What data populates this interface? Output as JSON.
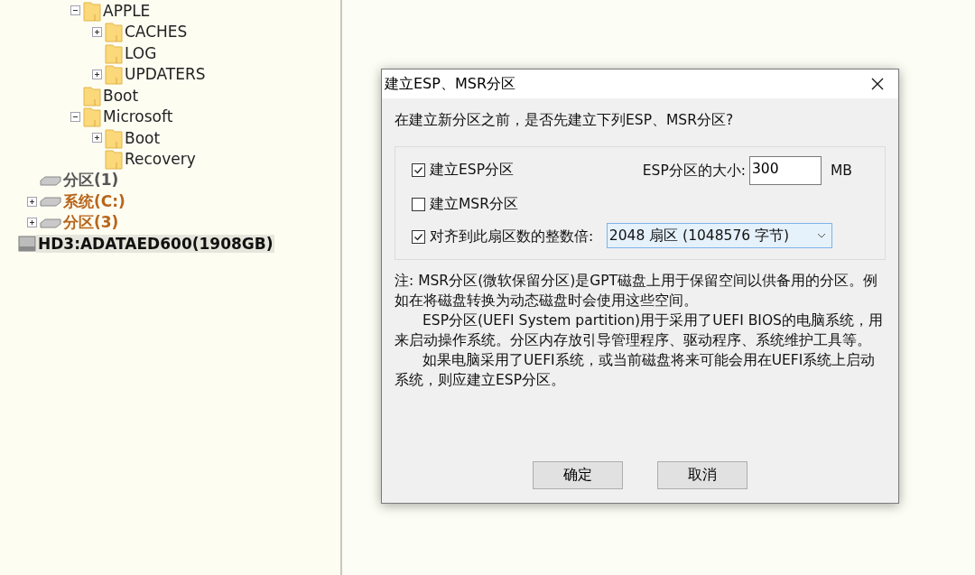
{
  "tree": [
    {
      "children": [
        {
          "children": [
            {
              "children": [
                {
                  "kind": "folder",
                  "label": "APPLE",
                  "expanded": true,
                  "selected": false,
                  "children": [
                    {
                      "kind": "folder",
                      "label": "CACHES",
                      "expanded": false,
                      "selected": false
                    },
                    {
                      "kind": "folder",
                      "label": "LOG",
                      "selected": false
                    },
                    {
                      "kind": "folder",
                      "label": "UPDATERS",
                      "expanded": false,
                      "selected": false
                    }
                  ]
                },
                {
                  "kind": "folder",
                  "label": "Boot",
                  "selected": false
                },
                {
                  "kind": "folder",
                  "label": "Microsoft",
                  "expanded": true,
                  "selected": false,
                  "children": [
                    {
                      "kind": "folder",
                      "label": "Boot",
                      "expanded": false,
                      "selected": false
                    },
                    {
                      "kind": "folder",
                      "label": "Recovery",
                      "selected": false
                    }
                  ]
                }
              ]
            }
          ]
        },
        {
          "kind": "partition",
          "label": "分区(1)",
          "color": "#555555",
          "selected": false
        },
        {
          "kind": "partition",
          "label": "系统(C:)",
          "color": "#b8651b",
          "expanded": false,
          "selected": false
        },
        {
          "kind": "partition",
          "label": "分区(3)",
          "color": "#b8651b",
          "expanded": false,
          "selected": false
        }
      ]
    },
    {
      "kind": "disk",
      "label": "HD3:ADATAED600(1908GB)",
      "selected": true
    }
  ],
  "dialog": {
    "title": "建立ESP、MSR分区",
    "question": "在建立新分区之前，是否先建立下列ESP、MSR分区?",
    "esp": {
      "label": "建立ESP分区",
      "checked": true
    },
    "size_label": "ESP分区的大小:",
    "size_value": "300",
    "size_unit": "MB",
    "msr": {
      "label": "建立MSR分区",
      "checked": false
    },
    "align": {
      "label": "对齐到此扇区数的整数倍:",
      "checked": true
    },
    "align_value": "2048 扇区 (1048576 字节)",
    "notes": [
      "注: MSR分区(微软保留分区)是GPT磁盘上用于保留空间以供备用的分区。例如在将磁盘转换为动态磁盘时会使用这些空间。",
      "ESP分区(UEFI System partition)用于采用了UEFI BIOS的电脑系统，用来启动操作系统。分区内存放引导管理程序、驱动程序、系统维护工具等。",
      "如果电脑采用了UEFI系统，或当前磁盘将来可能会用在UEFI系统上启动系统，则应建立ESP分区。"
    ],
    "buttons": [
      "确定",
      "取消"
    ]
  }
}
